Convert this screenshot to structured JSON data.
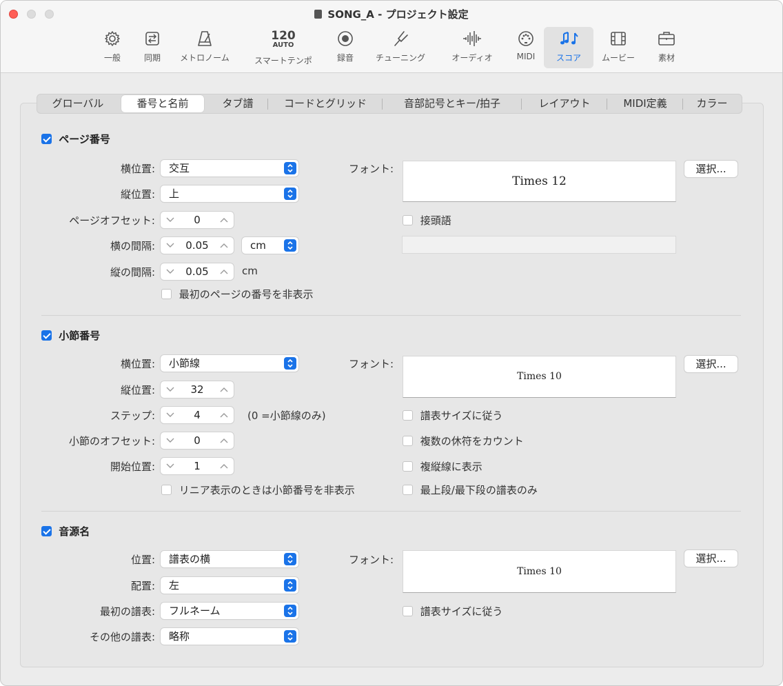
{
  "window": {
    "title": "SONG_A - プロジェクト設定"
  },
  "toolbar": {
    "items": [
      {
        "label": "一般",
        "icon": "gear-icon"
      },
      {
        "label": "同期",
        "icon": "sync-icon"
      },
      {
        "label": "メトロノーム",
        "icon": "metronome-icon"
      },
      {
        "label": "スマートテンポ",
        "icon": "tempo-icon",
        "tempo": "120",
        "tempo_mode": "AUTO"
      },
      {
        "label": "録音",
        "icon": "record-icon"
      },
      {
        "label": "チューニング",
        "icon": "tuning-fork-icon"
      },
      {
        "label": "オーディオ",
        "icon": "waveform-icon"
      },
      {
        "label": "MIDI",
        "icon": "midi-port-icon"
      },
      {
        "label": "スコア",
        "icon": "music-notes-icon",
        "active": true
      },
      {
        "label": "ムービー",
        "icon": "film-icon"
      },
      {
        "label": "素材",
        "icon": "briefcase-icon"
      }
    ]
  },
  "tabs": [
    "グローバル",
    "番号と名前",
    "タブ譜",
    "コードとグリッド",
    "音部記号とキー/拍子",
    "レイアウト",
    "MIDI定義",
    "カラー"
  ],
  "selected_tab": "番号と名前",
  "page_numbers": {
    "title": "ページ番号",
    "checked": true,
    "horizontal_label": "横位置:",
    "horizontal_value": "交互",
    "vertical_label": "縦位置:",
    "vertical_value": "上",
    "offset_label": "ページオフセット:",
    "offset_value": "0",
    "h_spacing_label": "横の間隔:",
    "h_spacing_value": "0.05",
    "h_spacing_unit": "cm",
    "v_spacing_label": "縦の間隔:",
    "v_spacing_value": "0.05",
    "v_spacing_unit": "cm",
    "hide_first_label": "最初のページの番号を非表示",
    "font_label": "フォント:",
    "font_value": "Times 12",
    "choose_label": "選択...",
    "prefix_label": "接頭語",
    "prefix_value": ""
  },
  "bar_numbers": {
    "title": "小節番号",
    "checked": true,
    "horizontal_label": "横位置:",
    "horizontal_value": "小節線",
    "vertical_label": "縦位置:",
    "vertical_value": "32",
    "step_label": "ステップ:",
    "step_value": "4",
    "step_note": "(0 =小節線のみ)",
    "offset_label": "小節のオフセット:",
    "offset_value": "0",
    "start_label": "開始位置:",
    "start_value": "1",
    "hide_linear_label": "リニア表示のときは小節番号を非表示",
    "font_label": "フォント:",
    "font_value": "Times 10",
    "choose_label": "選択...",
    "follow_size_label": "譜表サイズに従う",
    "count_rests_label": "複数の休符をカウント",
    "show_double_label": "複縦線に表示",
    "top_bottom_label": "最上段/最下段の譜表のみ"
  },
  "instrument_names": {
    "title": "音源名",
    "checked": true,
    "position_label": "位置:",
    "position_value": "譜表の横",
    "align_label": "配置:",
    "align_value": "左",
    "first_label": "最初の譜表:",
    "first_value": "フルネーム",
    "other_label": "その他の譜表:",
    "other_value": "略称",
    "font_label": "フォント:",
    "font_value": "Times 10",
    "choose_label": "選択...",
    "follow_size_label": "譜表サイズに従う"
  }
}
